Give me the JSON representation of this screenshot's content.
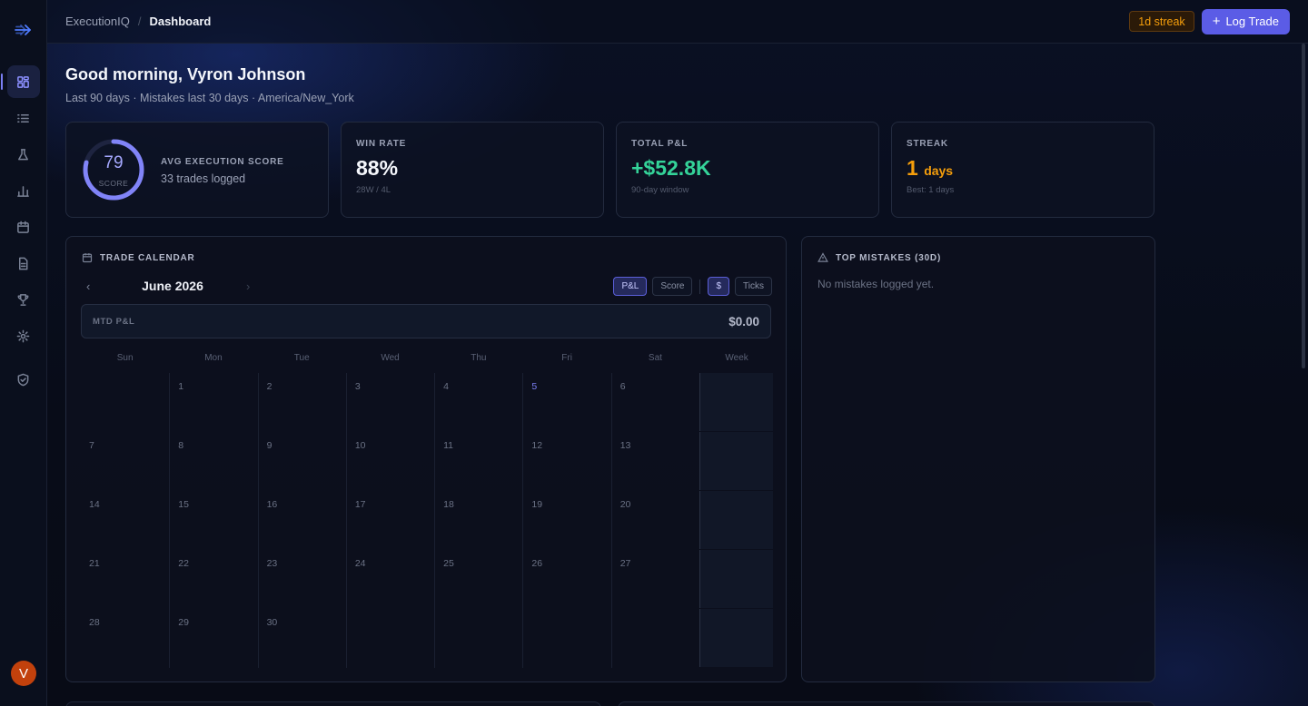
{
  "app": {
    "name": "ExecutionIQ"
  },
  "breadcrumb": {
    "root": "ExecutionIQ",
    "sep": "/",
    "current": "Dashboard"
  },
  "topbar": {
    "streak_badge": "1d streak",
    "log_trade_label": "Log Trade",
    "log_trade_icon": "plus-icon"
  },
  "sidebar": {
    "logo_icon": "arrows-logo-icon",
    "items": [
      {
        "id": "dashboard",
        "icon": "grid-icon",
        "active": true
      },
      {
        "id": "trades",
        "icon": "list-icon",
        "active": false
      },
      {
        "id": "lab",
        "icon": "flask-icon",
        "active": false
      },
      {
        "id": "analytics",
        "icon": "bar-chart-icon",
        "active": false
      },
      {
        "id": "calendar",
        "icon": "calendar-icon",
        "active": false
      },
      {
        "id": "reports",
        "icon": "document-icon",
        "active": false
      },
      {
        "id": "achievements",
        "icon": "trophy-icon",
        "active": false
      },
      {
        "id": "settings",
        "icon": "gear-icon",
        "active": false
      },
      {
        "id": "security",
        "icon": "shield-icon",
        "active": false
      }
    ],
    "avatar_initial": "V"
  },
  "header": {
    "greeting": "Good morning, Vyron Johnson",
    "subtitle": "Last 90 days · Mistakes last 30 days · America/New_York"
  },
  "cards": {
    "score": {
      "value": "79",
      "ring_fraction": 0.79,
      "ring_label": "SCORE",
      "label": "AVG EXECUTION SCORE",
      "sub": "33 trades logged"
    },
    "win_rate": {
      "label": "WIN RATE",
      "value": "88%",
      "sub": "28W / 4L"
    },
    "pnl": {
      "label": "TOTAL P&L",
      "value": "+$52.8K",
      "sub": "90-day window"
    },
    "streak": {
      "label": "STREAK",
      "value": "1",
      "unit": "days",
      "sub": "Best: 1 days"
    }
  },
  "calendar": {
    "title": "TRADE CALENDAR",
    "month": "June 2026",
    "toggles": {
      "pnl": "P&L",
      "score": "Score",
      "dollar": "$",
      "ticks": "Ticks"
    },
    "mtd_label": "MTD P&L",
    "mtd_value": "$0.00",
    "weekdays": [
      "Sun",
      "Mon",
      "Tue",
      "Wed",
      "Thu",
      "Fri",
      "Sat",
      "Week"
    ],
    "weeks": [
      [
        "",
        "1",
        "2",
        "3",
        "4",
        "5",
        "6"
      ],
      [
        "7",
        "8",
        "9",
        "10",
        "11",
        "12",
        "13"
      ],
      [
        "14",
        "15",
        "16",
        "17",
        "18",
        "19",
        "20"
      ],
      [
        "21",
        "22",
        "23",
        "24",
        "25",
        "26",
        "27"
      ],
      [
        "28",
        "29",
        "30",
        "",
        "",
        "",
        ""
      ]
    ],
    "today": "5"
  },
  "mistakes": {
    "title": "TOP MISTAKES (30D)",
    "empty": "No mistakes logged yet."
  },
  "colors": {
    "accent": "#5b5ce6",
    "positive": "#34d399",
    "streak": "#f59e0b",
    "avatar": "#c2410c"
  }
}
